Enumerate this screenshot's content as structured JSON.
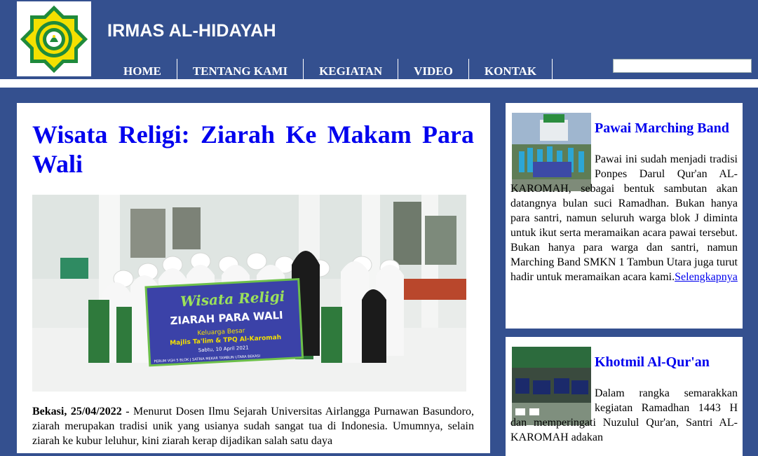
{
  "header": {
    "site_title": "IRMAS AL-HIDAYAH",
    "logo_icon": "emblem-star-icon",
    "colors": {
      "bar": "#34508f",
      "logo_green": "#1f8a3b",
      "logo_yellow": "#f4e000"
    }
  },
  "nav": {
    "items": [
      "HOME",
      "TENTANG KAMI",
      "KEGIATAN",
      "VIDEO",
      "KONTAK"
    ]
  },
  "search": {
    "value": "",
    "placeholder": ""
  },
  "post": {
    "title": "Wisata Religi: Ziarah Ke Makam Para Wali",
    "banner": {
      "line1": "Wisata Religi",
      "line2": "ZIARAH PARA WALI",
      "line3": "Keluarga Besar",
      "line4": "Majlis Ta'lim & TPQ Al-Karomah",
      "line5": "Sabtu, 10 April 2021",
      "line6": "PERUM VGH 5 BLOK J SATRIA MEKAR TAMBUN UTARA BEKASI"
    },
    "dateline": "Bekasi, 25/04/2022",
    "body": " - Menurut Dosen Ilmu Sejarah Universitas Airlangga Purnawan Basundoro, ziarah merupakan tradisi unik yang usianya sudah sangat tua di Indonesia. Umumnya, selain ziarah ke kubur leluhur, kini ziarah kerap dijadikan salah satu daya"
  },
  "sidebar": {
    "cards": [
      {
        "title": "Pawai Marching Band",
        "text": "Pawai ini sudah menjadi tradisi Ponpes Darul Qur'an AL-KAROMAH, sebagai bentuk sambutan akan datangnya bulan suci Ramadhan. Bukan hanya para santri, namun seluruh warga blok J diminta untuk ikut serta meramaikan acara pawai tersebut. Bukan hanya para warga dan santri, namun Marching Band SMKN 1 Tambun Utara juga turut hadir untuk meramaikan acara kami.",
        "link": "Selengkapnya"
      },
      {
        "title": "Khotmil Al-Qur'an",
        "text": "Dalam rangka semarakkan kegiatan Ramadhan 1443 H dan memperingati Nuzulul Qur'an, Santri AL-KAROMAH adakan"
      }
    ]
  }
}
